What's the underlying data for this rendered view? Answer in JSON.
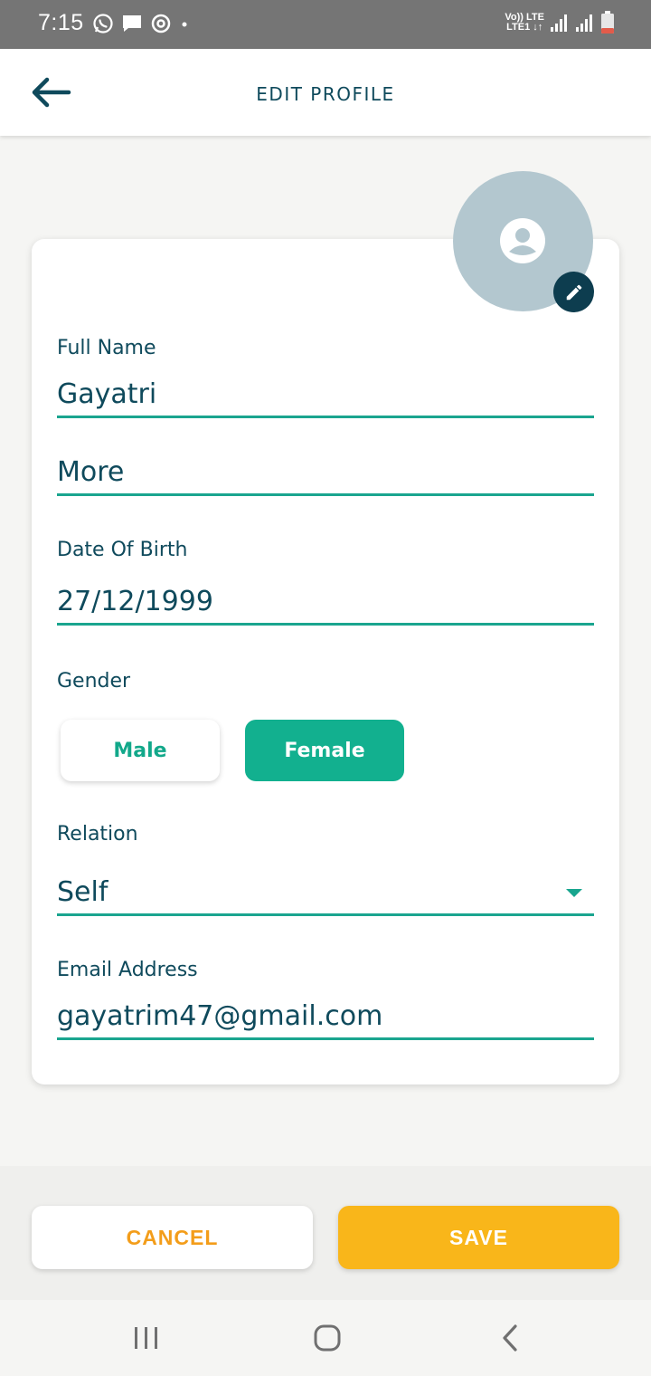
{
  "status_bar": {
    "time": "7:15",
    "network_top": "Vo)) LTE",
    "network_bottom": "LTE1 ↓↑",
    "icons": [
      "whatsapp-icon",
      "message-icon",
      "sync-icon",
      "dot-icon",
      "signal-icon",
      "signal-icon",
      "battery-icon"
    ]
  },
  "header": {
    "title": "EDIT PROFILE",
    "back_icon": "arrow-left-icon"
  },
  "profile": {
    "avatar_icon": "account-circle-icon",
    "edit_icon": "pencil-icon"
  },
  "form": {
    "full_name_label": "Full Name",
    "first_name": "Gayatri",
    "last_name": "More",
    "dob_label": "Date Of Birth",
    "dob_value": "27/12/1999",
    "gender_label": "Gender",
    "gender_options": [
      "Male",
      "Female"
    ],
    "gender_selected": "Female",
    "relation_label": "Relation",
    "relation_value": "Self",
    "email_label": "Email Address",
    "email_value": "gayatrim47@gmail.com"
  },
  "footer": {
    "cancel_label": "CANCEL",
    "save_label": "SAVE"
  },
  "colors": {
    "accent_teal": "#12b08f",
    "accent_orange": "#f9b61a",
    "text_dark": "#0f4a5c",
    "avatar_bg": "#b3c7cf"
  },
  "nav": {
    "recents_icon": "recents-icon",
    "home_icon": "home-icon",
    "back_icon": "back-chevron-icon"
  }
}
